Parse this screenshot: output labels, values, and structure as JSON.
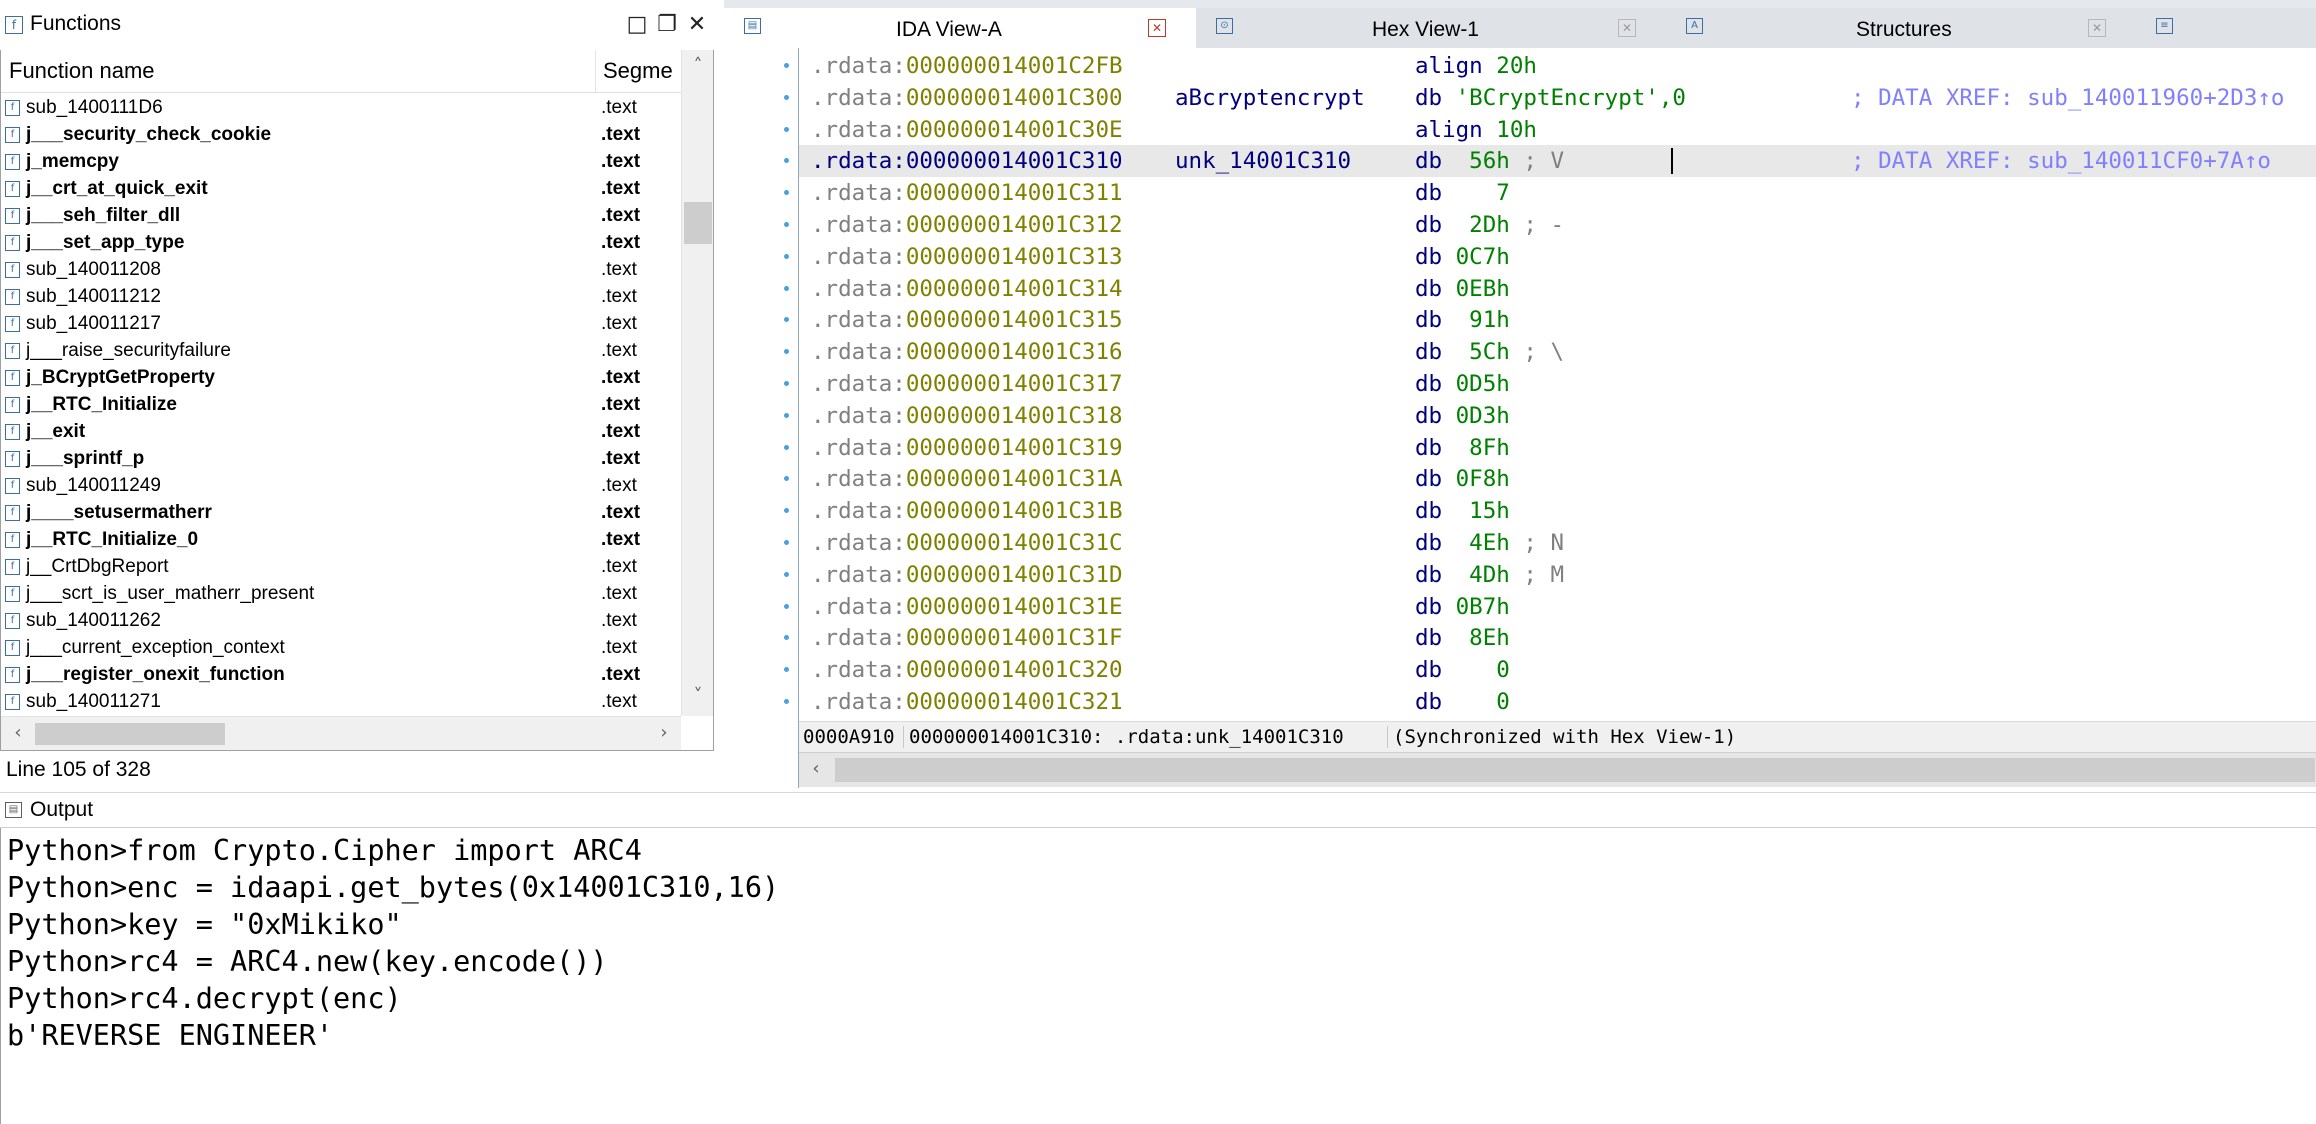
{
  "functions_panel": {
    "title": "Functions",
    "title_icon": "function-icon",
    "window_buttons": [
      "maximize-icon",
      "restore-icon",
      "close-icon"
    ],
    "columns": {
      "name": "Function name",
      "segment": "Segme"
    },
    "rows": [
      {
        "name": "sub_1400111D6",
        "segment": ".text",
        "bold": false
      },
      {
        "name": "j___security_check_cookie",
        "segment": ".text",
        "bold": true
      },
      {
        "name": "j_memcpy",
        "segment": ".text",
        "bold": true
      },
      {
        "name": "j__crt_at_quick_exit",
        "segment": ".text",
        "bold": true
      },
      {
        "name": "j___seh_filter_dll",
        "segment": ".text",
        "bold": true
      },
      {
        "name": "j___set_app_type",
        "segment": ".text",
        "bold": true
      },
      {
        "name": "sub_140011208",
        "segment": ".text",
        "bold": false
      },
      {
        "name": "sub_140011212",
        "segment": ".text",
        "bold": false
      },
      {
        "name": "sub_140011217",
        "segment": ".text",
        "bold": false
      },
      {
        "name": "j___raise_securityfailure",
        "segment": ".text",
        "bold": false
      },
      {
        "name": "j_BCryptGetProperty",
        "segment": ".text",
        "bold": true
      },
      {
        "name": "j__RTC_Initialize",
        "segment": ".text",
        "bold": true
      },
      {
        "name": "j__exit",
        "segment": ".text",
        "bold": true
      },
      {
        "name": "j___sprintf_p",
        "segment": ".text",
        "bold": true
      },
      {
        "name": "sub_140011249",
        "segment": ".text",
        "bold": false
      },
      {
        "name": "j____setusermatherr",
        "segment": ".text",
        "bold": true
      },
      {
        "name": "j__RTC_Initialize_0",
        "segment": ".text",
        "bold": true
      },
      {
        "name": "j__CrtDbgReport",
        "segment": ".text",
        "bold": false
      },
      {
        "name": "j___scrt_is_user_matherr_present",
        "segment": ".text",
        "bold": false
      },
      {
        "name": "sub_140011262",
        "segment": ".text",
        "bold": false
      },
      {
        "name": "j___current_exception_context",
        "segment": ".text",
        "bold": false
      },
      {
        "name": "j___register_onexit_function",
        "segment": ".text",
        "bold": true
      },
      {
        "name": "sub_140011271",
        "segment": ".text",
        "bold": false
      }
    ],
    "status": "Line 105 of 328"
  },
  "tabs": [
    {
      "label": "IDA View-A",
      "icon": "ida-view-icon",
      "active": true
    },
    {
      "label": "Hex View-1",
      "icon": "hex-view-icon",
      "active": false
    },
    {
      "label": "Structures",
      "icon": "structures-icon",
      "active": false
    }
  ],
  "ida_view": {
    "lines": [
      {
        "addr": ".rdata:000000014001C2FB",
        "label": "",
        "mnem": "align",
        "operand": "20h",
        "comment": "",
        "xref": ""
      },
      {
        "addr": ".rdata:000000014001C300",
        "label": "aBcryptencrypt",
        "mnem": "db",
        "operand": "'BCryptEncrypt',0",
        "comment": "",
        "xref": "; DATA XREF: sub_140011960+2D3↑o"
      },
      {
        "addr": ".rdata:000000014001C30E",
        "label": "",
        "mnem": "align",
        "operand": "10h",
        "comment": "",
        "xref": ""
      },
      {
        "addr": ".rdata:000000014001C310",
        "label": "unk_14001C310",
        "mnem": "db",
        "operand": " 56h",
        "comment": "; V",
        "xref": "; DATA XREF: sub_140011CF0+7A↑o"
      },
      {
        "addr": ".rdata:000000014001C311",
        "label": "",
        "mnem": "db",
        "operand": "   7",
        "comment": "",
        "xref": ""
      },
      {
        "addr": ".rdata:000000014001C312",
        "label": "",
        "mnem": "db",
        "operand": " 2Dh",
        "comment": "; -",
        "xref": ""
      },
      {
        "addr": ".rdata:000000014001C313",
        "label": "",
        "mnem": "db",
        "operand": "0C7h",
        "comment": "",
        "xref": ""
      },
      {
        "addr": ".rdata:000000014001C314",
        "label": "",
        "mnem": "db",
        "operand": "0EBh",
        "comment": "",
        "xref": ""
      },
      {
        "addr": ".rdata:000000014001C315",
        "label": "",
        "mnem": "db",
        "operand": " 91h",
        "comment": "",
        "xref": ""
      },
      {
        "addr": ".rdata:000000014001C316",
        "label": "",
        "mnem": "db",
        "operand": " 5Ch",
        "comment": "; \\",
        "xref": ""
      },
      {
        "addr": ".rdata:000000014001C317",
        "label": "",
        "mnem": "db",
        "operand": "0D5h",
        "comment": "",
        "xref": ""
      },
      {
        "addr": ".rdata:000000014001C318",
        "label": "",
        "mnem": "db",
        "operand": "0D3h",
        "comment": "",
        "xref": ""
      },
      {
        "addr": ".rdata:000000014001C319",
        "label": "",
        "mnem": "db",
        "operand": " 8Fh",
        "comment": "",
        "xref": ""
      },
      {
        "addr": ".rdata:000000014001C31A",
        "label": "",
        "mnem": "db",
        "operand": "0F8h",
        "comment": "",
        "xref": ""
      },
      {
        "addr": ".rdata:000000014001C31B",
        "label": "",
        "mnem": "db",
        "operand": " 15h",
        "comment": "",
        "xref": ""
      },
      {
        "addr": ".rdata:000000014001C31C",
        "label": "",
        "mnem": "db",
        "operand": " 4Eh",
        "comment": "; N",
        "xref": ""
      },
      {
        "addr": ".rdata:000000014001C31D",
        "label": "",
        "mnem": "db",
        "operand": " 4Dh",
        "comment": "; M",
        "xref": ""
      },
      {
        "addr": ".rdata:000000014001C31E",
        "label": "",
        "mnem": "db",
        "operand": "0B7h",
        "comment": "",
        "xref": ""
      },
      {
        "addr": ".rdata:000000014001C31F",
        "label": "",
        "mnem": "db",
        "operand": " 8Eh",
        "comment": "",
        "xref": ""
      },
      {
        "addr": ".rdata:000000014001C320",
        "label": "",
        "mnem": "db",
        "operand": "   0",
        "comment": "",
        "xref": ""
      },
      {
        "addr": ".rdata:000000014001C321",
        "label": "",
        "mnem": "db",
        "operand": "   0",
        "comment": "",
        "xref": ""
      }
    ],
    "status": {
      "offset": "0000A910",
      "location": "000000014001C310: .rdata:unk_14001C310",
      "sync": "(Synchronized with Hex View-1)"
    }
  },
  "output": {
    "title": "Output",
    "lines": [
      "Python>from Crypto.Cipher import ARC4",
      "Python>enc = idaapi.get_bytes(0x14001C310,16)",
      "Python>key = \"0xMikiko\"",
      "Python>rc4 = ARC4.new(key.encode())",
      "Python>rc4.decrypt(enc)",
      "b'REVERSE ENGINEER'"
    ]
  },
  "colors": {
    "address": "#808000",
    "address_segment": "#000080",
    "keyword": "#000080",
    "string_operand": "#008000",
    "comment": "#808080",
    "xref": "#8080ff",
    "highlight_row": "#e8e8e8"
  }
}
